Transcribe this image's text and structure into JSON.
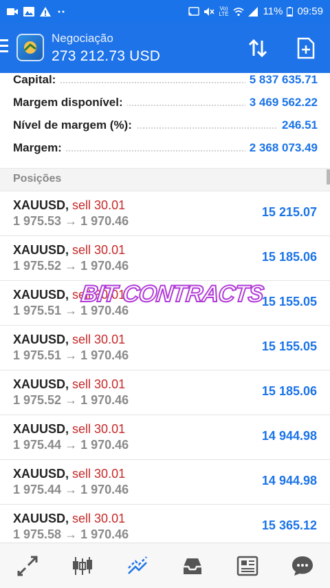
{
  "status_bar": {
    "battery": "11%",
    "time": "09:59",
    "lte_label": "LTE",
    "volte_label": "Vo)"
  },
  "app_bar": {
    "title": "Negociação",
    "balance": "273 212.73 USD",
    "icons": [
      "menu-icon",
      "mt-logo-icon",
      "sort-icon",
      "new-order-icon"
    ]
  },
  "summary": [
    {
      "label": "Capital:",
      "value": "5 837 635.71"
    },
    {
      "label": "Margem disponível:",
      "value": "3 469 562.22"
    },
    {
      "label": "Nível de margem (%):",
      "value": "246.51"
    },
    {
      "label": "Margem:",
      "value": "2 368 073.49"
    }
  ],
  "section_title": "Posições",
  "positions": [
    {
      "symbol": "XAUUSD,",
      "side": "sell 30.01",
      "prices": "1 975.53 → 1 970.46",
      "profit": "15 215.07"
    },
    {
      "symbol": "XAUUSD,",
      "side": "sell 30.01",
      "prices": "1 975.52 → 1 970.46",
      "profit": "15 185.06"
    },
    {
      "symbol": "XAUUSD,",
      "side": "sell 30.01",
      "prices": "1 975.51 → 1 970.46",
      "profit": "15 155.05"
    },
    {
      "symbol": "XAUUSD,",
      "side": "sell 30.01",
      "prices": "1 975.51 → 1 970.46",
      "profit": "15 155.05"
    },
    {
      "symbol": "XAUUSD,",
      "side": "sell 30.01",
      "prices": "1 975.52 → 1 970.46",
      "profit": "15 185.06"
    },
    {
      "symbol": "XAUUSD,",
      "side": "sell 30.01",
      "prices": "1 975.44 → 1 970.46",
      "profit": "14 944.98"
    },
    {
      "symbol": "XAUUSD,",
      "side": "sell 30.01",
      "prices": "1 975.44 → 1 970.46",
      "profit": "14 944.98"
    },
    {
      "symbol": "XAUUSD,",
      "side": "sell 30.01",
      "prices": "1 975.58 → 1 970.46",
      "profit": "15 365.12"
    }
  ],
  "watermark": "BIT CONTRACTS",
  "bottom_nav": [
    "quotes-icon",
    "chart-icon",
    "trade-icon",
    "history-icon",
    "news-icon",
    "chat-icon"
  ],
  "colors": {
    "accent": "#1a73e8",
    "sell": "#c62828",
    "watermark": "#b13ad8"
  }
}
